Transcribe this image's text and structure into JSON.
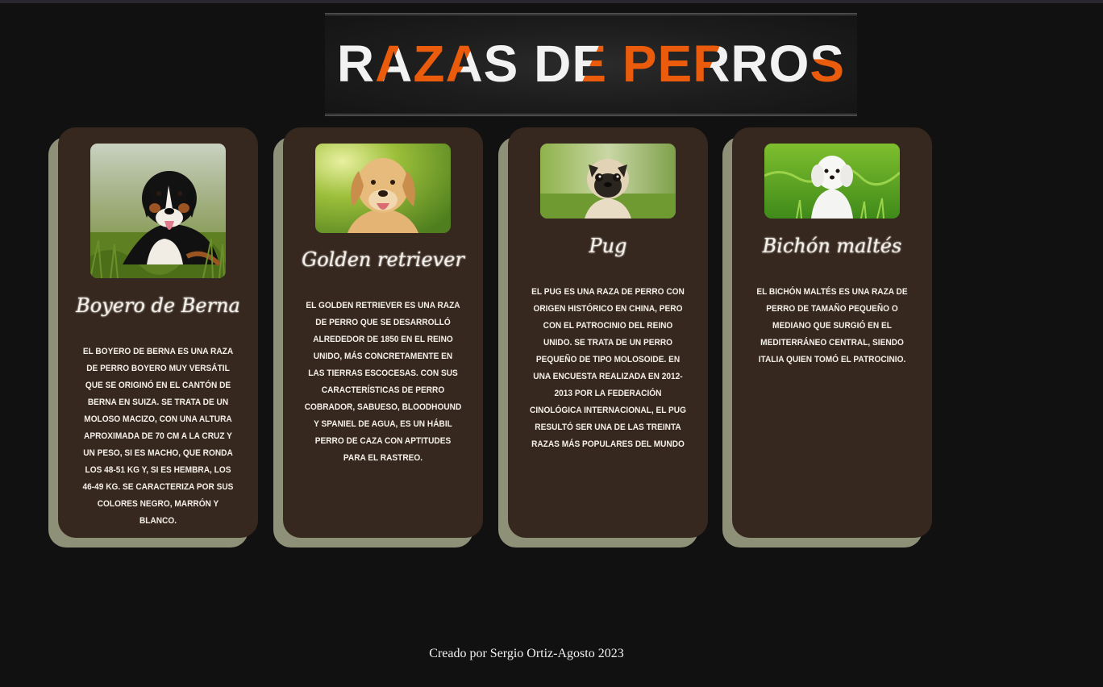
{
  "page": {
    "title_parts": [
      "R",
      "A",
      "Z",
      "A",
      "S",
      " ",
      "D",
      "E",
      " ",
      "P",
      "E",
      "R",
      "R",
      "O",
      "S"
    ],
    "footer": "Creado por Sergio Ortiz-Agosto 2023"
  },
  "colors": {
    "background": "#111111",
    "card": "#36281e",
    "card_shadow": "#8e9078",
    "accent": "#ea5b0c",
    "text": "#f2f2f2"
  },
  "cards": [
    {
      "title": "Boyero de Berna",
      "photo": "bernese-mountain-dog-photo",
      "text": "El Boyero de Berna es una raza de perro boyero muy versátil que se originó en el cantón de Berna en Suiza. Se trata de un moloso macizo, con una altura aproximada de 70 cm a la cruz y un peso, si es macho, que ronda los 48-51 kg y, si es hembra, los 46-49 kg. Se caracteriza por sus colores negro, marrón y blanco."
    },
    {
      "title": "Golden retriever",
      "photo": "golden-retriever-photo",
      "text": "El golden retriever es una raza de perro que se desarrolló alrededor de 1850 en el Reino Unido, más concretamente en las Tierras Escocesas. Con sus características de perro cobrador, sabueso, bloodhound y spaniel de agua, es un hábil perro de caza con aptitudes para el rastreo."
    },
    {
      "title": "Pug",
      "photo": "pug-photo",
      "text": "El pug es una raza de perro con origen histórico en China, pero con el patrocinio del Reino Unido. Se trata de un perro pequeño de tipo molosoide. En una encuesta realizada en 2012-2013 por la Federación Cinológica Internacional, el pug resultó ser una de las treinta razas más populares del mundo"
    },
    {
      "title": "Bichón maltés",
      "photo": "maltese-photo",
      "text": "El bichón maltés es una raza de perro de tamaño pequeño o mediano que surgió en el Mediterráneo central, siendo Italia quien tomó el patrocinio."
    }
  ]
}
